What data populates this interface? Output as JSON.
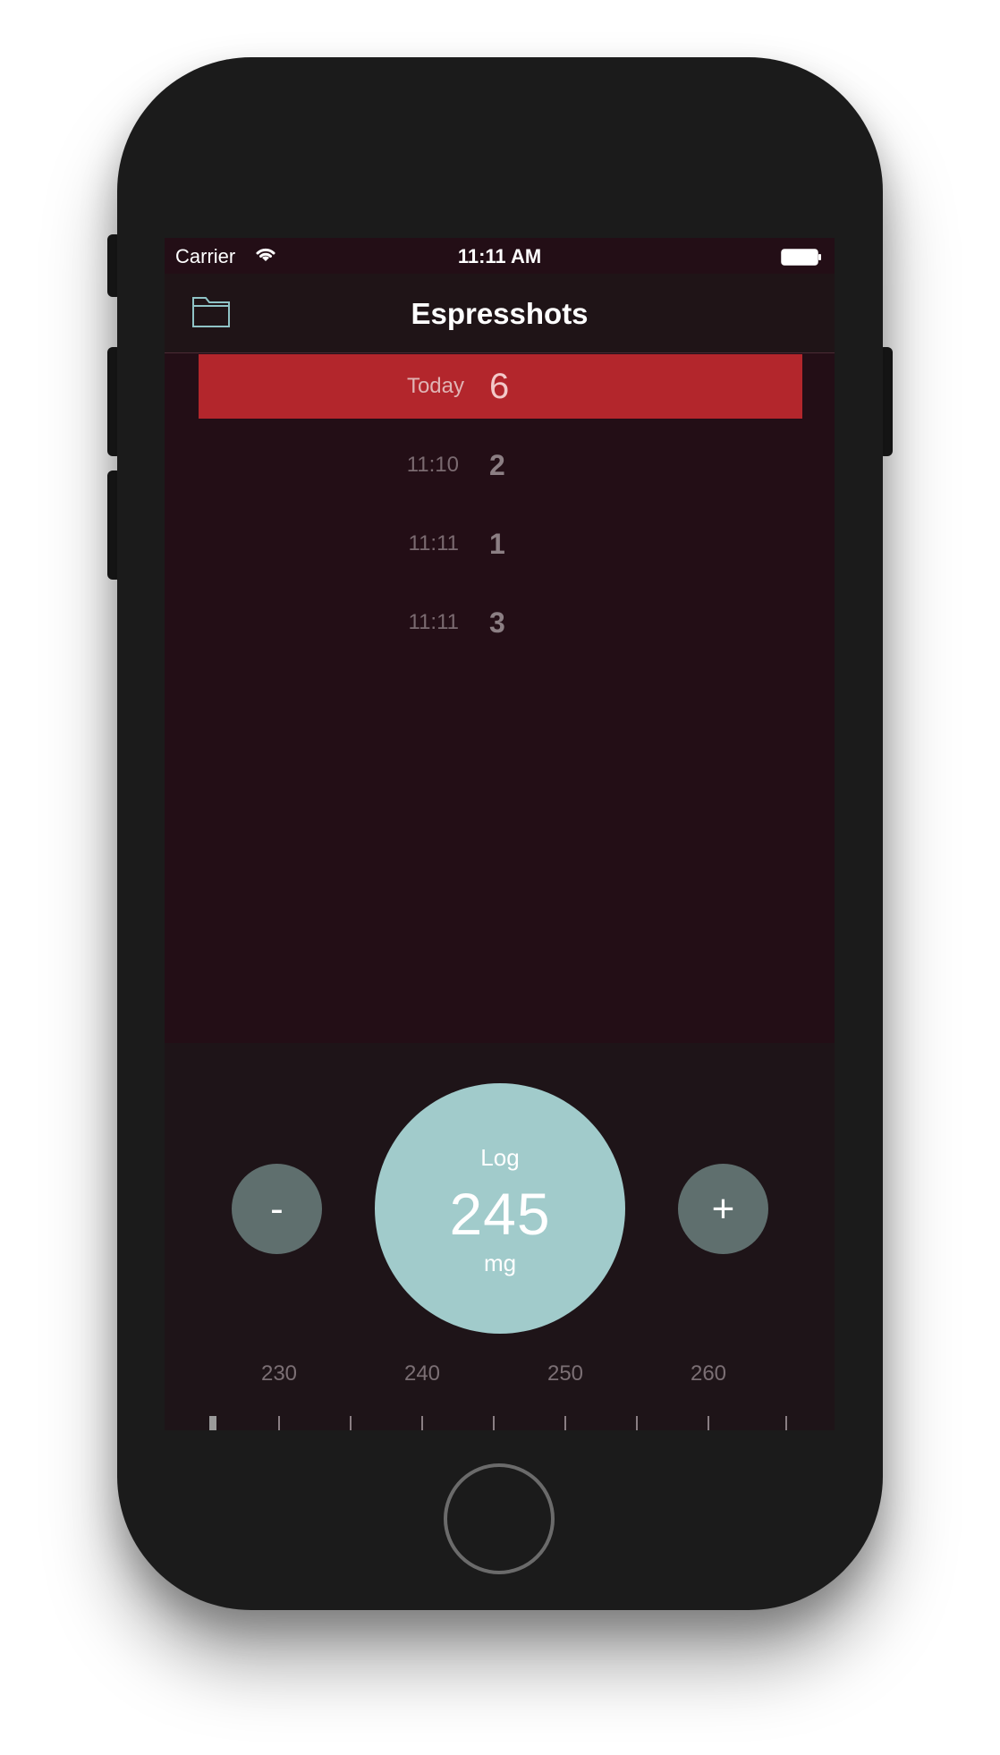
{
  "status_bar": {
    "carrier": "Carrier",
    "time": "11:11 AM"
  },
  "nav": {
    "title": "Espresshots",
    "left_icon": "folder-icon"
  },
  "shots": {
    "today": {
      "label": "Today",
      "count": "6"
    },
    "entries": [
      {
        "time": "11:10",
        "count": "2"
      },
      {
        "time": "11:11",
        "count": "1"
      },
      {
        "time": "11:11",
        "count": "3"
      }
    ]
  },
  "controls": {
    "decrement_label": "-",
    "increment_label": "+",
    "log_label": "Log",
    "amount": "245",
    "unit": "mg"
  },
  "ruler": {
    "labels": [
      "230",
      "240",
      "250",
      "260"
    ]
  },
  "colors": {
    "screen_background": "#230e16",
    "today_row": "#b3262c",
    "log_button": "#a1cbcb",
    "stepper_button": "#5f6f6e"
  }
}
